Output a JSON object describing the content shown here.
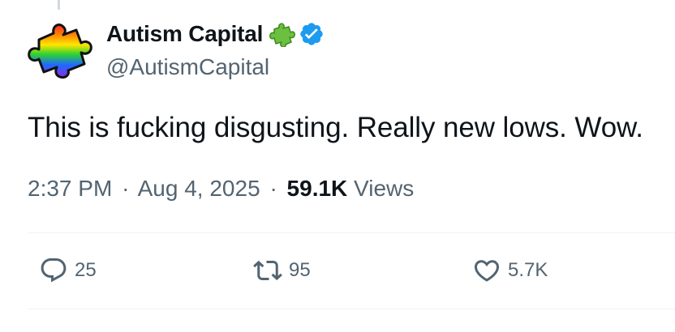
{
  "tweet": {
    "author": {
      "display_name": "Autism Capital",
      "handle": "@AutismCapital",
      "avatar_icon": "rainbow-puzzle-piece-icon",
      "name_emoji_icon": "green-puzzle-piece-icon",
      "verified_icon": "verified-badge-icon",
      "verified_color": "#1d9bf0"
    },
    "text": "This is fucking disgusting. Really new lows. Wow.",
    "meta": {
      "time": "2:37 PM",
      "separator": "·",
      "date": "Aug 4, 2025",
      "views_count": "59.1K",
      "views_label": "Views"
    },
    "actions": {
      "reply": {
        "icon": "reply-bubble-icon",
        "count": "25"
      },
      "retweet": {
        "icon": "retweet-icon",
        "count": "95"
      },
      "like": {
        "icon": "heart-icon",
        "count": "5.7K"
      }
    }
  },
  "colors": {
    "text_primary": "#0f1419",
    "text_secondary": "#536471",
    "divider": "#eff3f4",
    "thread_line": "#cfd9de"
  }
}
